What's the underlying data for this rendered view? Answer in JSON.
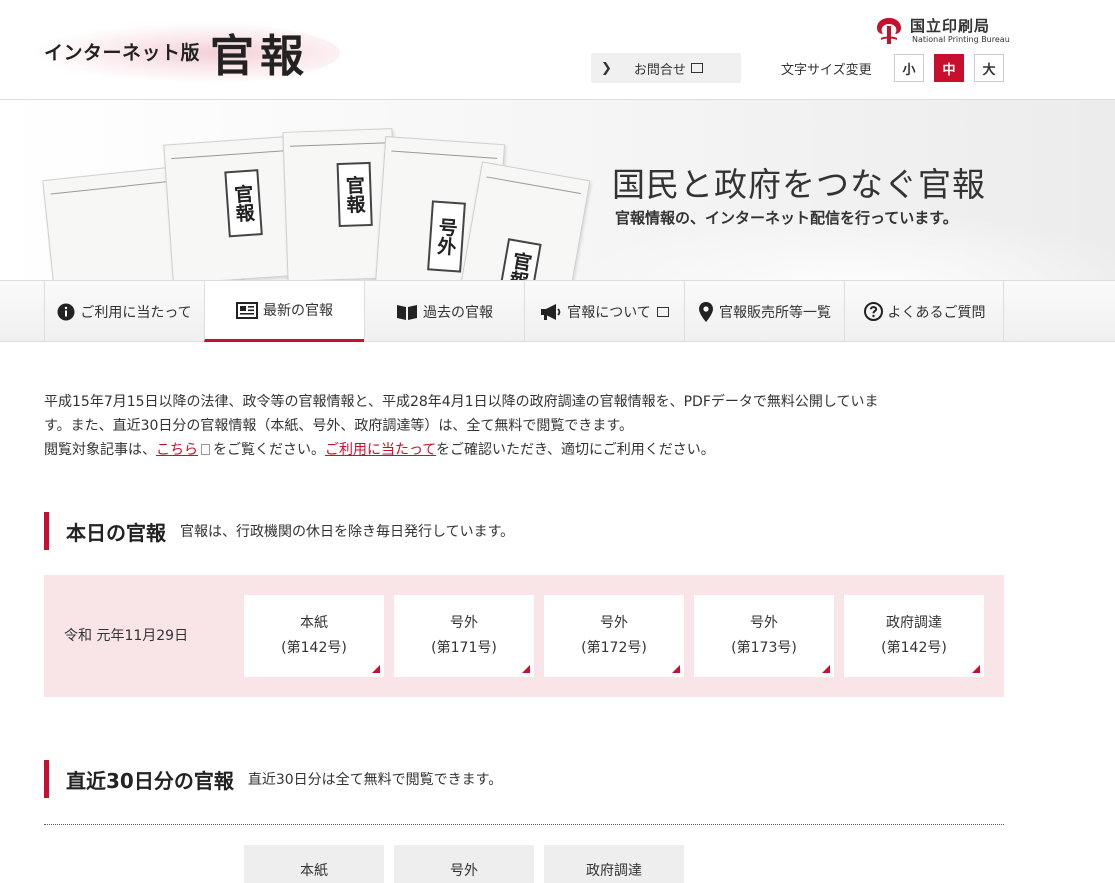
{
  "header": {
    "logo_sub": "インターネット版",
    "logo_main": "官報",
    "bureau_jp": "国立印刷局",
    "bureau_en": "National Printing Bureau",
    "contact_label": "お問合せ",
    "font_size_label": "文字サイズ変更",
    "font_sizes": [
      "小",
      "中",
      "大"
    ],
    "font_size_selected": "中"
  },
  "hero": {
    "title": "国民と政府をつなぐ官報",
    "subtitle": "官報情報の、インターネット配信を行っています。"
  },
  "nav": {
    "items": [
      {
        "label": "ご利用に当たって",
        "icon": "info-icon"
      },
      {
        "label": "最新の官報",
        "icon": "newspaper-icon",
        "active": true
      },
      {
        "label": "過去の官報",
        "icon": "book-icon"
      },
      {
        "label": "官報について",
        "icon": "megaphone-icon",
        "external": true
      },
      {
        "label": "官報販売所等一覧",
        "icon": "map-pin-icon"
      },
      {
        "label": "よくあるご質問",
        "icon": "question-icon"
      }
    ]
  },
  "intro": {
    "line1": "平成15年7月15日以降の法律、政令等の官報情報と、平成28年4月1日以降の政府調達の官報情報を、PDFデータで無料公開していま",
    "line2": "す。また、直近30日分の官報情報（本紙、号外、政府調達等）は、全て無料で閲覧できます。",
    "line3_pre": "閲覧対象記事は、",
    "link1": "こちら",
    "line3_mid": "をご覧ください。",
    "link2": "ご利用に当たって",
    "line3_post": "をご確認いただき、適切にご利用ください。"
  },
  "today": {
    "heading": "本日の官報",
    "desc": "官報は、行政機関の休日を除き毎日発行しています。",
    "date": "令和 元年11月29日",
    "cards": [
      {
        "type": "本紙",
        "number": "(第142号)"
      },
      {
        "type": "号外",
        "number": "(第171号)"
      },
      {
        "type": "号外",
        "number": "(第172号)"
      },
      {
        "type": "号外",
        "number": "(第173号)"
      },
      {
        "type": "政府調達",
        "number": "(第142号)"
      }
    ]
  },
  "recent": {
    "heading": "直近30日分の官報",
    "desc": "直近30日分は全て無料で閲覧できます。",
    "cards": [
      {
        "type": "本紙"
      },
      {
        "type": "号外"
      },
      {
        "type": "政府調達"
      }
    ]
  },
  "colors": {
    "accent": "#c8102e",
    "today_bg": "#f9e4e8"
  }
}
